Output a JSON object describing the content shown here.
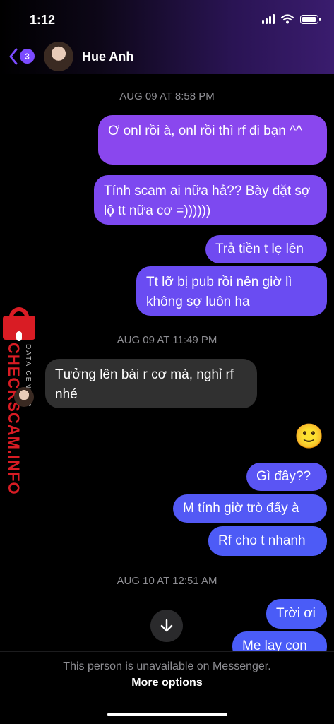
{
  "status_bar": {
    "time": "1:12"
  },
  "header": {
    "back_badge_count": "3",
    "contact_name": "Hue Anh"
  },
  "messages": {
    "ts1": "AUG 09 AT 8:58 PM",
    "m1": "Ơ onl rồi à, onl rồi thì rf đi bạn ^^",
    "m2": "Tính scam ai nữa hả?? Bày đặt sợ lộ tt nữa cơ =))))))",
    "m3": "Trả tiền t lẹ lên",
    "m4": "Tt lỡ bị pub rồi nên giờ lì không sợ luôn ha",
    "ts2": "AUG 09 AT 11:49 PM",
    "m5": "Tưởng lên bài r cơ mà, nghỉ rf nhé",
    "emoji": "🙂",
    "m6": "Gì đây??",
    "m7": "M tính giờ trò đấy à",
    "m8": "Rf cho t nhanh",
    "ts3": "AUG 10 AT 12:51 AM",
    "m9": "Trời ơi",
    "m10": "Me lay con"
  },
  "watermark": {
    "brand": "CHECKSCAM.INFO",
    "tagline": "DATA CENTER"
  },
  "footer": {
    "note": "This person is unavailable on Messenger.",
    "link": "More options"
  },
  "colors": {
    "bubble_top": "#8a47ee",
    "bubble_mid": "#6a4cf2",
    "bubble_bottom": "#4a5cf7",
    "incoming": "#303030",
    "badge": "#7b4bff",
    "watermark_red": "#d91c24"
  }
}
